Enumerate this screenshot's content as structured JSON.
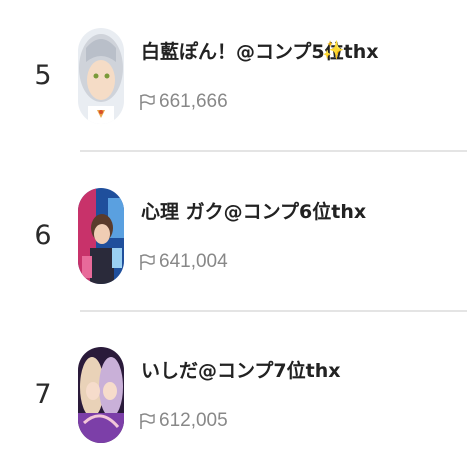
{
  "ranking": {
    "items": [
      {
        "rank": "5",
        "name": "白藍ぽん！@コンプ5位thx",
        "sparkle": "✨",
        "count": "661,666",
        "count_icon": "flag-icon",
        "avatar_colors": [
          "#cfd3da",
          "#f5dcc6",
          "#e8a34a"
        ]
      },
      {
        "rank": "6",
        "name": "心理 ガク@コンプ6位thx",
        "count": "641,004",
        "count_icon": "flag-icon",
        "avatar_colors": [
          "#2b74c8",
          "#c8326a",
          "#5a3b2b"
        ]
      },
      {
        "rank": "7",
        "name": "いしだ@コンプ7位thx",
        "count": "612,005",
        "count_icon": "flag-icon",
        "avatar_colors": [
          "#7c3fa8",
          "#f2c6d8",
          "#2a1a3a"
        ]
      }
    ]
  },
  "colors": {
    "rank_text": "#2a2a2a",
    "name_text": "#222222",
    "count_text": "#888888",
    "divider": "#e4e4e4",
    "sparkle": "#f2c230"
  }
}
